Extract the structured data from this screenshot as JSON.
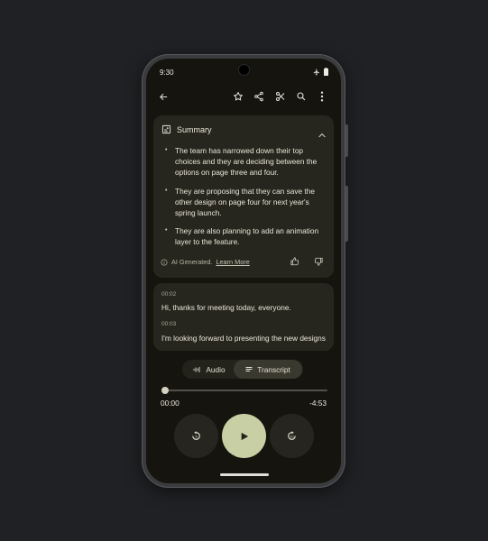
{
  "status": {
    "time": "9:30"
  },
  "summary": {
    "title": "Summary",
    "bullets": [
      "The team has narrowed down their top choices and they are deciding between the options on page three and four.",
      "They are proposing that they can save the other design on page four for next year's spring launch.",
      "They are also planning to add an animation layer to the feature."
    ],
    "ai_label": "AI Generated.",
    "learn_more": "Learn More"
  },
  "transcript": {
    "entries": [
      {
        "time": "00:02",
        "text": "Hi, thanks for meeting today, everyone."
      },
      {
        "time": "00:03",
        "text": "I'm looking forward to presenting the new designs"
      }
    ]
  },
  "tabs": {
    "audio": "Audio",
    "transcript": "Transcript"
  },
  "player": {
    "elapsed": "00:00",
    "remaining": "-4:53",
    "progress_fraction": 0.0
  },
  "colors": {
    "accent": "#c9cfa5",
    "card": "#27261e",
    "screen_bg": "#16140f"
  },
  "icons": [
    "back-arrow-icon",
    "star-icon",
    "share-icon",
    "scissors-icon",
    "search-icon",
    "more-vert-icon",
    "summary-icon",
    "chevron-up-icon",
    "info-icon",
    "thumb-up-icon",
    "thumb-down-icon",
    "waveform-icon",
    "lines-icon",
    "replay-icon",
    "play-icon",
    "forward-icon"
  ]
}
